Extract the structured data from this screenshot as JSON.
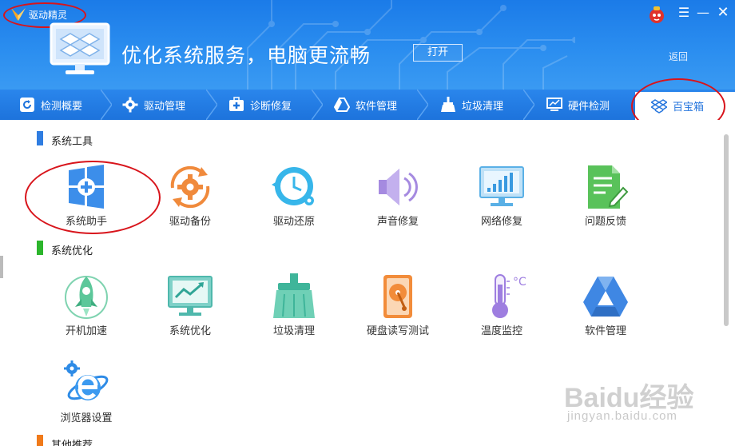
{
  "window": {
    "title": "驱动精灵",
    "menu_glyph": "☰",
    "minimize_glyph": "—",
    "close_glyph": "✕"
  },
  "hero": {
    "title": "优化系统服务，电脑更流畅",
    "open_label": "打开",
    "back_label": "返回"
  },
  "tabs": [
    {
      "label": "检测概要",
      "icon": "refresh-icon"
    },
    {
      "label": "驱动管理",
      "icon": "gear-icon"
    },
    {
      "label": "诊断修复",
      "icon": "medkit-icon"
    },
    {
      "label": "软件管理",
      "icon": "triangle-drive-icon"
    },
    {
      "label": "垃圾清理",
      "icon": "broom-icon"
    },
    {
      "label": "硬件检测",
      "icon": "monitor-chart-icon"
    },
    {
      "label": "百宝箱",
      "icon": "dropbox-icon",
      "active": true
    }
  ],
  "sections": [
    {
      "title": "系统工具",
      "color": "#2f7de1",
      "tools": [
        {
          "label": "系统助手",
          "icon": "windows-plus-icon"
        },
        {
          "label": "驱动备份",
          "icon": "gear-sync-icon"
        },
        {
          "label": "驱动还原",
          "icon": "clock-restore-icon"
        },
        {
          "label": "声音修复",
          "icon": "speaker-icon"
        },
        {
          "label": "网络修复",
          "icon": "network-monitor-icon"
        },
        {
          "label": "问题反馈",
          "icon": "feedback-edit-icon"
        }
      ]
    },
    {
      "title": "系统优化",
      "color": "#2cb52c",
      "tools": [
        {
          "label": "开机加速",
          "icon": "rocket-icon"
        },
        {
          "label": "系统优化",
          "icon": "monitor-trend-icon"
        },
        {
          "label": "垃圾清理",
          "icon": "broom-icon"
        },
        {
          "label": "硬盘读写测试",
          "icon": "hard-disk-icon"
        },
        {
          "label": "温度监控",
          "icon": "thermometer-icon"
        },
        {
          "label": "软件管理",
          "icon": "triangle-drive-icon"
        },
        {
          "label": "浏览器设置",
          "icon": "ie-gear-icon"
        }
      ]
    },
    {
      "title": "其他推荐",
      "color": "#f07a1a",
      "tools": []
    }
  ],
  "watermark": {
    "logo": "Baidu经验",
    "url": "jingyan.baidu.com"
  }
}
